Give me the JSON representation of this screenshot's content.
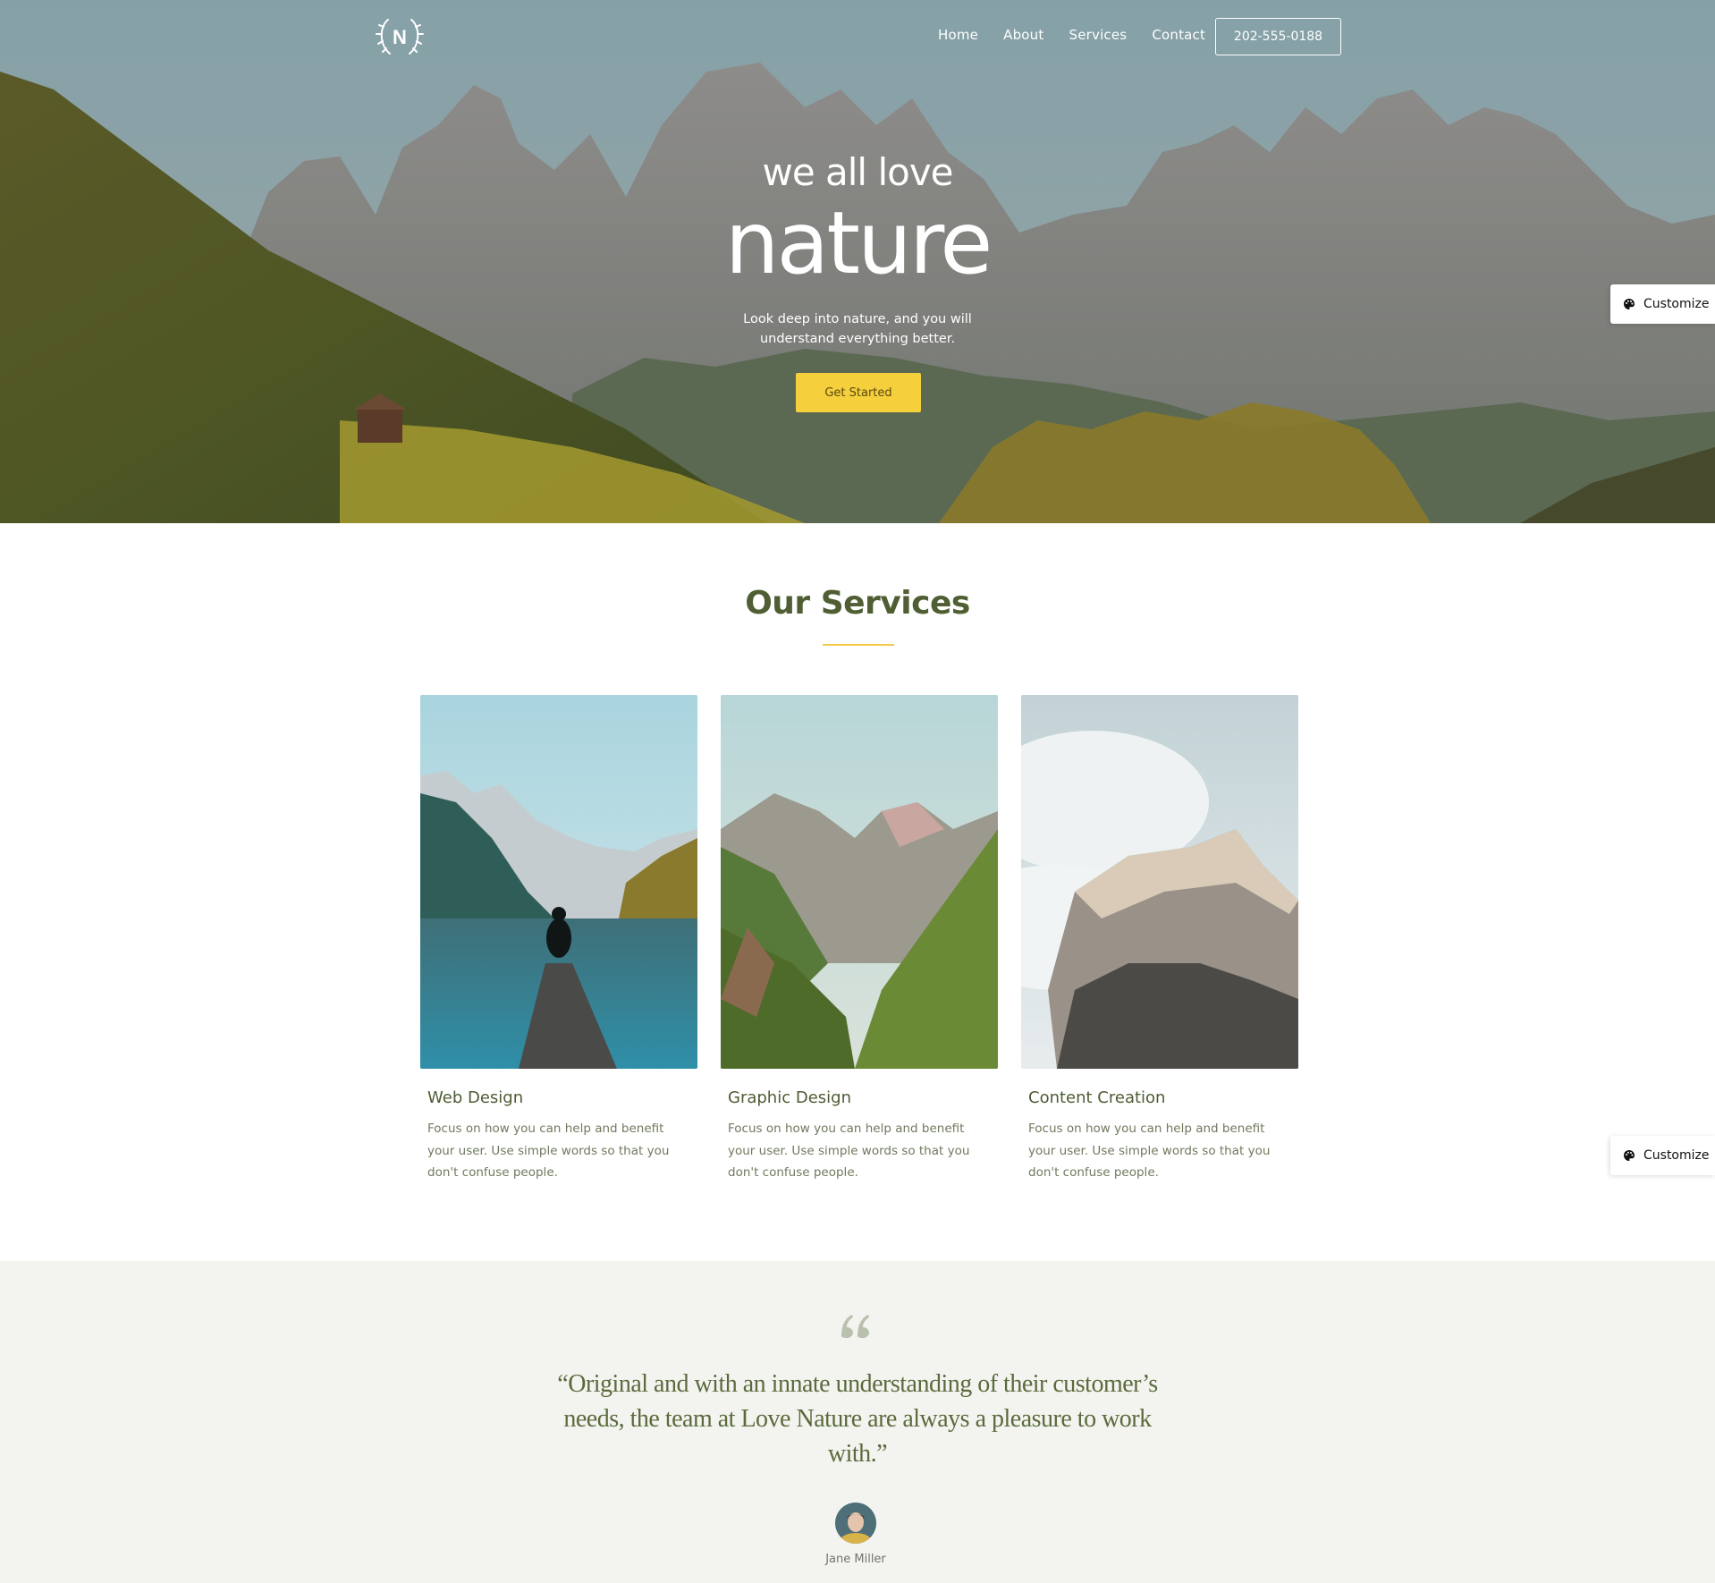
{
  "brand": {
    "logo_letter": "N",
    "logo_icon": "laurel-wreath-icon"
  },
  "nav": {
    "items": [
      "Home",
      "About",
      "Services",
      "Contact"
    ],
    "phone": "202-555-0188"
  },
  "hero": {
    "subtitle": "we all love",
    "title": "nature",
    "description": "Look deep into nature, and you will understand everything better.",
    "cta_label": "Get Started"
  },
  "customize": {
    "label": "Customize",
    "icon": "palette-icon"
  },
  "services": {
    "title": "Our Services",
    "cards": [
      {
        "title": "Web Design",
        "text": "Focus on how you can help and benefit your user. Use simple words so that you don't confuse people."
      },
      {
        "title": "Graphic Design",
        "text": "Focus on how you can help and benefit your user. Use simple words so that you don't confuse people."
      },
      {
        "title": "Content Creation",
        "text": "Focus on how you can help and benefit your user. Use simple words so that you don't confuse people."
      }
    ]
  },
  "testimonial": {
    "quote": "“Original and with an innate understanding of their customer’s needs, the team at Love Nature are always a pleasure to work with.”",
    "author": "Jane Miller"
  },
  "colors": {
    "accent": "#f5cf3c",
    "heading": "#4f5e33",
    "testimonial_bg": "#f3f4f0"
  }
}
